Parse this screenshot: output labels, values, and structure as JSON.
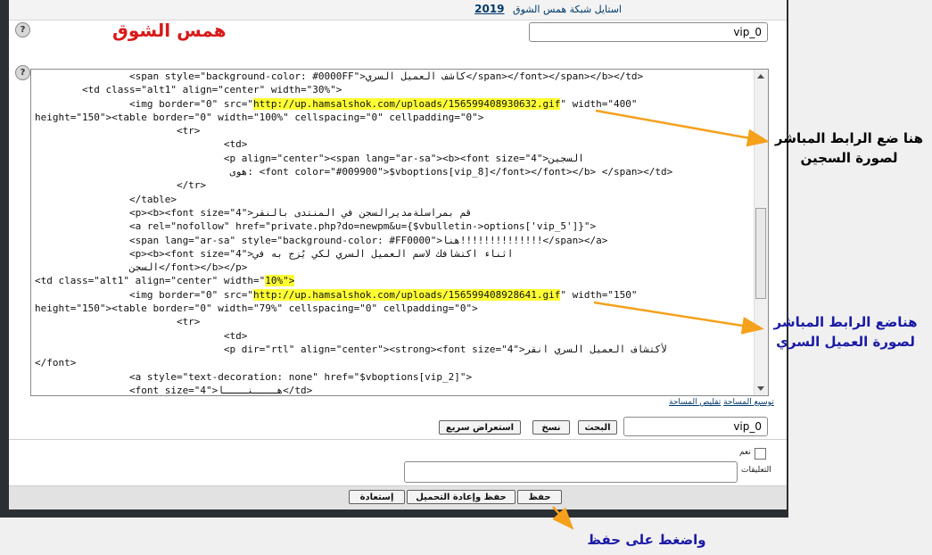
{
  "breadcrumb": {
    "text": "استايل شبكة همس الشوق",
    "year": "2019"
  },
  "header": {
    "title": "همس الشوق",
    "help_icon": "?",
    "var_name": "vip_0"
  },
  "editor": {
    "help_icon": "?",
    "lines": [
      {
        "pre": "                <span style=\"background-color: #0000FF\">كاشف العميل السري</span></font></span></b></td>",
        "hl": "",
        "post": ""
      },
      {
        "pre": "        <td class=\"alt1\" align=\"center\" width=\"30%\">",
        "hl": "",
        "post": ""
      },
      {
        "pre": "                <img border=\"0\" src=\"",
        "hl": "http://up.hamsalshok.com/uploads/156599408930632.gif",
        "post": "\" width=\"400\""
      },
      {
        "pre": "height=\"150\"><table border=\"0\" width=\"100%\" cellspacing=\"0\" cellpadding=\"0\">",
        "hl": "",
        "post": ""
      },
      {
        "pre": "                        <tr>",
        "hl": "",
        "post": ""
      },
      {
        "pre": "                                <td>",
        "hl": "",
        "post": ""
      },
      {
        "pre": "                                <p align=\"center\"><span lang=\"ar-sa\"><b><font size=\"4\">السجين",
        "hl": "",
        "post": ""
      },
      {
        "pre": "                                 هوى: <font color=\"#009900\">$vboptions[vip_8]</font></font></b> </span></td>",
        "hl": "",
        "post": ""
      },
      {
        "pre": "                        </tr>",
        "hl": "",
        "post": ""
      },
      {
        "pre": "                </table>",
        "hl": "",
        "post": ""
      },
      {
        "pre": "                <p><b><font size=\"4\">قم بمراسلةمديرالسجن في المنتدى بالنقر",
        "hl": "",
        "post": ""
      },
      {
        "pre": "                <a rel=\"nofollow\" href=\"private.php?do=newpm&u={$vbulletin->options['vip_5']}\">",
        "hl": "",
        "post": ""
      },
      {
        "pre": "                <span lang=\"ar-sa\" style=\"background-color: #FF0000\">هنا!!!!!!!!!!!!!!</span></a>",
        "hl": "",
        "post": ""
      },
      {
        "pre": "                <p><b><font size=\"4\">اثناء اكتشافك لاسم العميل السري لكي يُزج به في",
        "hl": "",
        "post": ""
      },
      {
        "pre": "                السجن</font></b></p>",
        "hl": "",
        "post": ""
      },
      {
        "pre": "<td class=\"alt1\" align=\"center\" width=\"",
        "hl": "10%\">",
        "post": ""
      },
      {
        "pre": "                <img border=\"0\" src=\"",
        "hl": "http://up.hamsalshok.com/uploads/156599408928641.gif",
        "post": "\" width=\"150\""
      },
      {
        "pre": "height=\"150\"><table border=\"0\" width=\"79%\" cellspacing=\"0\" cellpadding=\"0\">",
        "hl": "",
        "post": ""
      },
      {
        "pre": "                        <tr>",
        "hl": "",
        "post": ""
      },
      {
        "pre": "                                <td>",
        "hl": "",
        "post": ""
      },
      {
        "pre": "                                <p dir=\"rtl\" align=\"center\"><strong><font size=\"4\">لأكتشاف العميل السري انقر",
        "hl": "",
        "post": ""
      },
      {
        "pre": "</font>",
        "hl": "",
        "post": ""
      },
      {
        "pre": "                <a style=\"text-decoration: none\" href=\"$vboptions[vip_2]\">",
        "hl": "",
        "post": ""
      },
      {
        "pre": "                <font size=\"4\">هــــنــــا</td>",
        "hl": "",
        "post": ""
      }
    ]
  },
  "resize": {
    "expand": "توسيع المساحة",
    "shrink": "تقليص المساحة"
  },
  "toolbar": {
    "var_value": "vip_0",
    "search": "البحث",
    "copy": "نسخ",
    "quick_preview": "استعراض سريع"
  },
  "comments": {
    "checkbox_label": "نعم",
    "label": "التعليقات"
  },
  "footer": {
    "save": "حفظ",
    "save_reload": "حفظ وإعادة التحميل",
    "restore": "إستعادة"
  },
  "annotations": {
    "prisoner_note": "هنا ضع الرابط المباشر لصورة السجين",
    "agent_note": "هناضع الرابط المباشر لصورة العميل السري",
    "save_note": "واضغط على حفظ"
  }
}
